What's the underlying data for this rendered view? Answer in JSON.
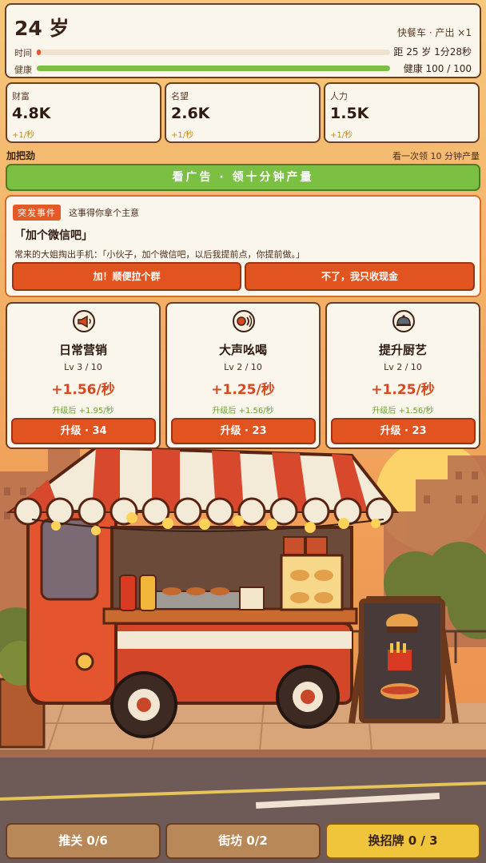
{
  "header": {
    "age": "24 岁",
    "meta": "快餐车 · 产出 ×1",
    "time_label": "时间",
    "time_progress": 0.01,
    "time_info": "距 25 岁 1分28秒",
    "health_label": "健康",
    "health_progress": 1.0,
    "health_info": "健康 100 / 100"
  },
  "stats": [
    {
      "label": "财富",
      "value": "4.8K",
      "rate": "+1/秒"
    },
    {
      "label": "名望",
      "value": "2.6K",
      "rate": "+1/秒"
    },
    {
      "label": "人力",
      "value": "1.5K",
      "rate": "+1/秒"
    }
  ],
  "boost": {
    "title": "加把劲",
    "note": "看一次领 10 分钟产量",
    "button": "看广告 · 领十分钟产量"
  },
  "event": {
    "tag": "突发事件",
    "subtitle": "这事得你拿个主意",
    "title": "「加个微信吧」",
    "body": "常来的大姐掏出手机：「小伙子，加个微信吧，以后我提前点，你提前做。」",
    "option_a": "加！顺便拉个群",
    "option_b": "不了，我只收现金"
  },
  "upgrades": [
    {
      "icon": "megaphone-icon",
      "name": "日常营销",
      "level": "Lv 3 / 10",
      "rate": "+1.56/秒",
      "next": "升级后 +1.95/秒",
      "button": "升级 · 34"
    },
    {
      "icon": "shout-icon",
      "name": "大声吆喝",
      "level": "Lv 2 / 10",
      "rate": "+1.25/秒",
      "next": "升级后 +1.56/秒",
      "button": "升级 · 23"
    },
    {
      "icon": "cloche-icon",
      "name": "提升厨艺",
      "level": "Lv 2 / 10",
      "rate": "+1.25/秒",
      "next": "升级后 +1.56/秒",
      "button": "升级 · 23"
    }
  ],
  "bottom_nav": {
    "tuiguan": "推关 0/6",
    "jiefang": "街坊 0/2",
    "signboard": "换招牌 0 / 3"
  },
  "colors": {
    "accent_orange": "#e2541f",
    "green": "#7cc043",
    "gold": "#f0c53c",
    "bar_time": "#e45a25",
    "bar_health": "#7cc043"
  }
}
